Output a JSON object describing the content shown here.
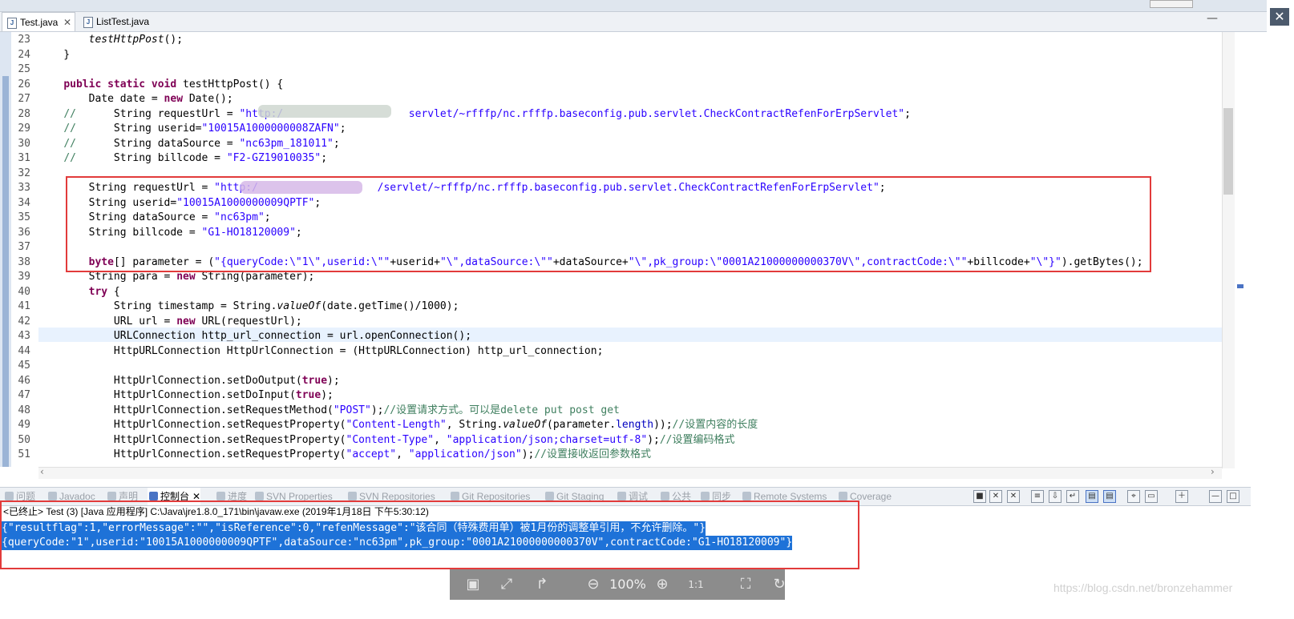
{
  "tabs": [
    {
      "label": "Test.java",
      "active": true
    },
    {
      "label": "ListTest.java",
      "active": false
    }
  ],
  "code_lines": [
    {
      "n": "23",
      "html": "    <span class=\"it\">testHttpPost</span>();"
    },
    {
      "n": "24",
      "html": "}"
    },
    {
      "n": "25",
      "html": ""
    },
    {
      "n": "26",
      "html": "<span class=\"kw\">public static void</span> testHttpPost() {"
    },
    {
      "n": "27",
      "html": "    Date date = <span class=\"kw\">new</span> Date();"
    },
    {
      "n": "28",
      "html": "<span class=\"cm\">//</span>      String requestUrl = <span class=\"str\">\"http:/                    servlet/~rfffp/nc.rfffp.baseconfig.pub.servlet.CheckContractRefenForErpServlet\"</span>;"
    },
    {
      "n": "29",
      "html": "<span class=\"cm\">//</span>      String userid=<span class=\"str\">\"10015A1000000008ZAFN\"</span>;"
    },
    {
      "n": "30",
      "html": "<span class=\"cm\">//</span>      String dataSource = <span class=\"str\">\"nc63pm_181011\"</span>;"
    },
    {
      "n": "31",
      "html": "<span class=\"cm\">//</span>      String billcode = <span class=\"str\">\"F2-GZ19010035\"</span>;"
    },
    {
      "n": "32",
      "html": ""
    },
    {
      "n": "33",
      "html": "    String requestUrl = <span class=\"str\">\"http:/                   /servlet/~rfffp/nc.rfffp.baseconfig.pub.servlet.CheckContractRefenForErpServlet\"</span>;"
    },
    {
      "n": "34",
      "html": "    String userid=<span class=\"str\">\"10015A1000000009QPTF\"</span>;"
    },
    {
      "n": "35",
      "html": "    String dataSource = <span class=\"str\">\"nc63pm\"</span>;"
    },
    {
      "n": "36",
      "html": "    String billcode = <span class=\"str\">\"G1-HO18120009\"</span>;"
    },
    {
      "n": "37",
      "html": ""
    },
    {
      "n": "38",
      "html": "    <span class=\"kw\">byte</span>[] parameter = (<span class=\"str\">\"{queryCode:\\\"1\\\",userid:\\\"\"</span>+userid+<span class=\"str\">\"\\\",dataSource:\\\"\"</span>+dataSource+<span class=\"str\">\"\\\",pk_group:\\\"0001A21000000000370V\\\",contractCode:\\\"\"</span>+billcode+<span class=\"str\">\"\\\"}\"</span>).getBytes();"
    },
    {
      "n": "39",
      "html": "    String para = <span class=\"kw\">new</span> String(parameter);"
    },
    {
      "n": "40",
      "html": "    <span class=\"kw\">try</span> {"
    },
    {
      "n": "41",
      "html": "        String timestamp = String.<span class=\"it\">valueOf</span>(date.getTime()/1000);"
    },
    {
      "n": "42",
      "html": "        URL url = <span class=\"kw\">new</span> URL(requestUrl);"
    },
    {
      "n": "43",
      "html": "        URLConnection http_url_connection = url.openConnection();"
    },
    {
      "n": "44",
      "html": "        HttpURLConnection HttpUrlConnection = (HttpURLConnection) http_url_connection;"
    },
    {
      "n": "45",
      "html": ""
    },
    {
      "n": "46",
      "html": "        HttpUrlConnection.setDoOutput(<span class=\"kw\">true</span>);"
    },
    {
      "n": "47",
      "html": "        HttpUrlConnection.setDoInput(<span class=\"kw\">true</span>);"
    },
    {
      "n": "48",
      "html": "        HttpUrlConnection.setRequestMethod(<span class=\"str\">\"POST\"</span>);<span class=\"cm\">//设置请求方式。可以是delete put post get</span>"
    },
    {
      "n": "49",
      "html": "        HttpUrlConnection.setRequestProperty(<span class=\"str\">\"Content-Length\"</span>, String.<span class=\"it\">valueOf</span>(parameter.<span class=\"fld\">length</span>));<span class=\"cm\">//设置内容的长度</span>"
    },
    {
      "n": "50",
      "html": "        HttpUrlConnection.setRequestProperty(<span class=\"str\">\"Content-Type\"</span>, <span class=\"str\">\"application/json;charset=utf-8\"</span>);<span class=\"cm\">//设置编码格式</span>"
    },
    {
      "n": "51",
      "html": "        HttpUrlConnection.setRequestProperty(<span class=\"str\">\"accept\"</span>, <span class=\"str\">\"application/json\"</span>);<span class=\"cm\">//设置接收返回参数格式</span>"
    }
  ],
  "views": [
    {
      "label": "问题"
    },
    {
      "label": "Javadoc"
    },
    {
      "label": "声明"
    },
    {
      "label": "控制台",
      "active": true
    },
    {
      "label": "进度"
    },
    {
      "label": "SVN Properties"
    },
    {
      "label": "SVN Repositories"
    },
    {
      "label": "Git Repositories"
    },
    {
      "label": "Git Staging"
    },
    {
      "label": "调试"
    },
    {
      "label": "公共"
    },
    {
      "label": "同步"
    },
    {
      "label": "Remote Systems"
    },
    {
      "label": "Coverage"
    }
  ],
  "console": {
    "header": "<已终止> Test (3)  [Java 应用程序] C:\\Java\\jre1.8.0_171\\bin\\javaw.exe  (2019年1月18日 下午5:30:12)",
    "lines": [
      "{\"resultflag\":1,\"errorMessage\":\"\",\"isReference\":0,\"refenMessage\":\"该合同（特殊费用单）被1月份的调整单引用，不允许删除。\"}",
      "{queryCode:\"1\",userid:\"10015A1000000009QPTF\",dataSource:\"nc63pm\",pk_group:\"0001A21000000000370V\",contractCode:\"G1-HO18120009\"}"
    ]
  },
  "viewer": {
    "zoom": "100%"
  },
  "watermark": "https://blog.csdn.net/bronzehammer"
}
